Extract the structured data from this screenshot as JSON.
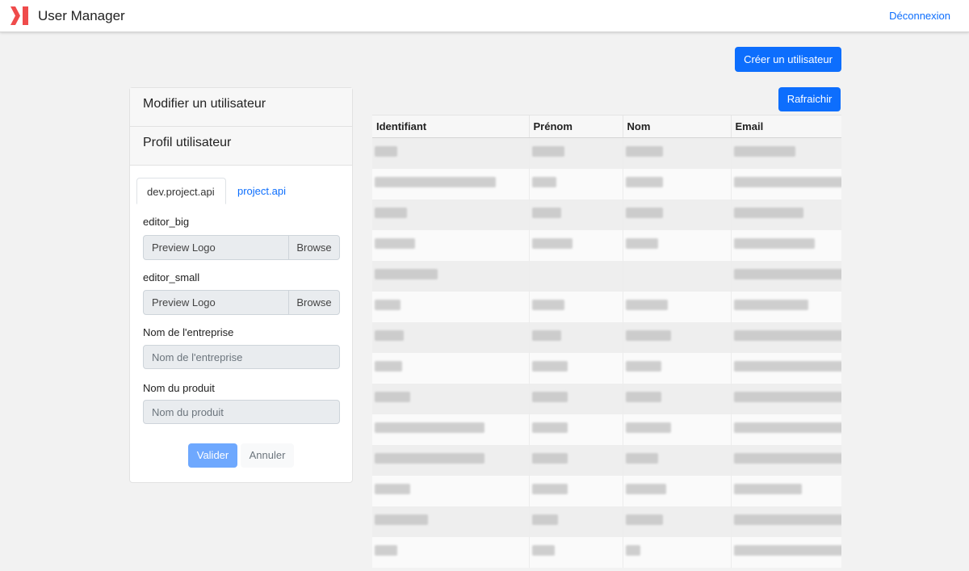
{
  "header": {
    "title": "User Manager",
    "logout_label": "Déconnexion"
  },
  "actions": {
    "create_label": "Créer un utilisateur",
    "refresh_label": "Rafraichir"
  },
  "edit_card": {
    "title": "Modifier un utilisateur",
    "profile_title": "Profil utilisateur",
    "tabs": [
      {
        "label": "dev.project.api",
        "active": true
      },
      {
        "label": "project.api",
        "active": false
      }
    ],
    "fields": {
      "editor_big": {
        "label": "editor_big",
        "value": "Preview Logo",
        "browse": "Browse"
      },
      "editor_small": {
        "label": "editor_small",
        "value": "Preview Logo",
        "browse": "Browse"
      },
      "company": {
        "label": "Nom de l'entreprise",
        "placeholder": "Nom de l'entreprise"
      },
      "product": {
        "label": "Nom du produit",
        "placeholder": "Nom du produit"
      }
    },
    "validate_label": "Valider",
    "cancel_label": "Annuler"
  },
  "table": {
    "columns": [
      "Identifiant",
      "Prénom",
      "Nom",
      "Email"
    ],
    "rows_note": "blurred"
  },
  "colors": {
    "primary": "#0d6efd",
    "logo": "#ef4b4b"
  }
}
